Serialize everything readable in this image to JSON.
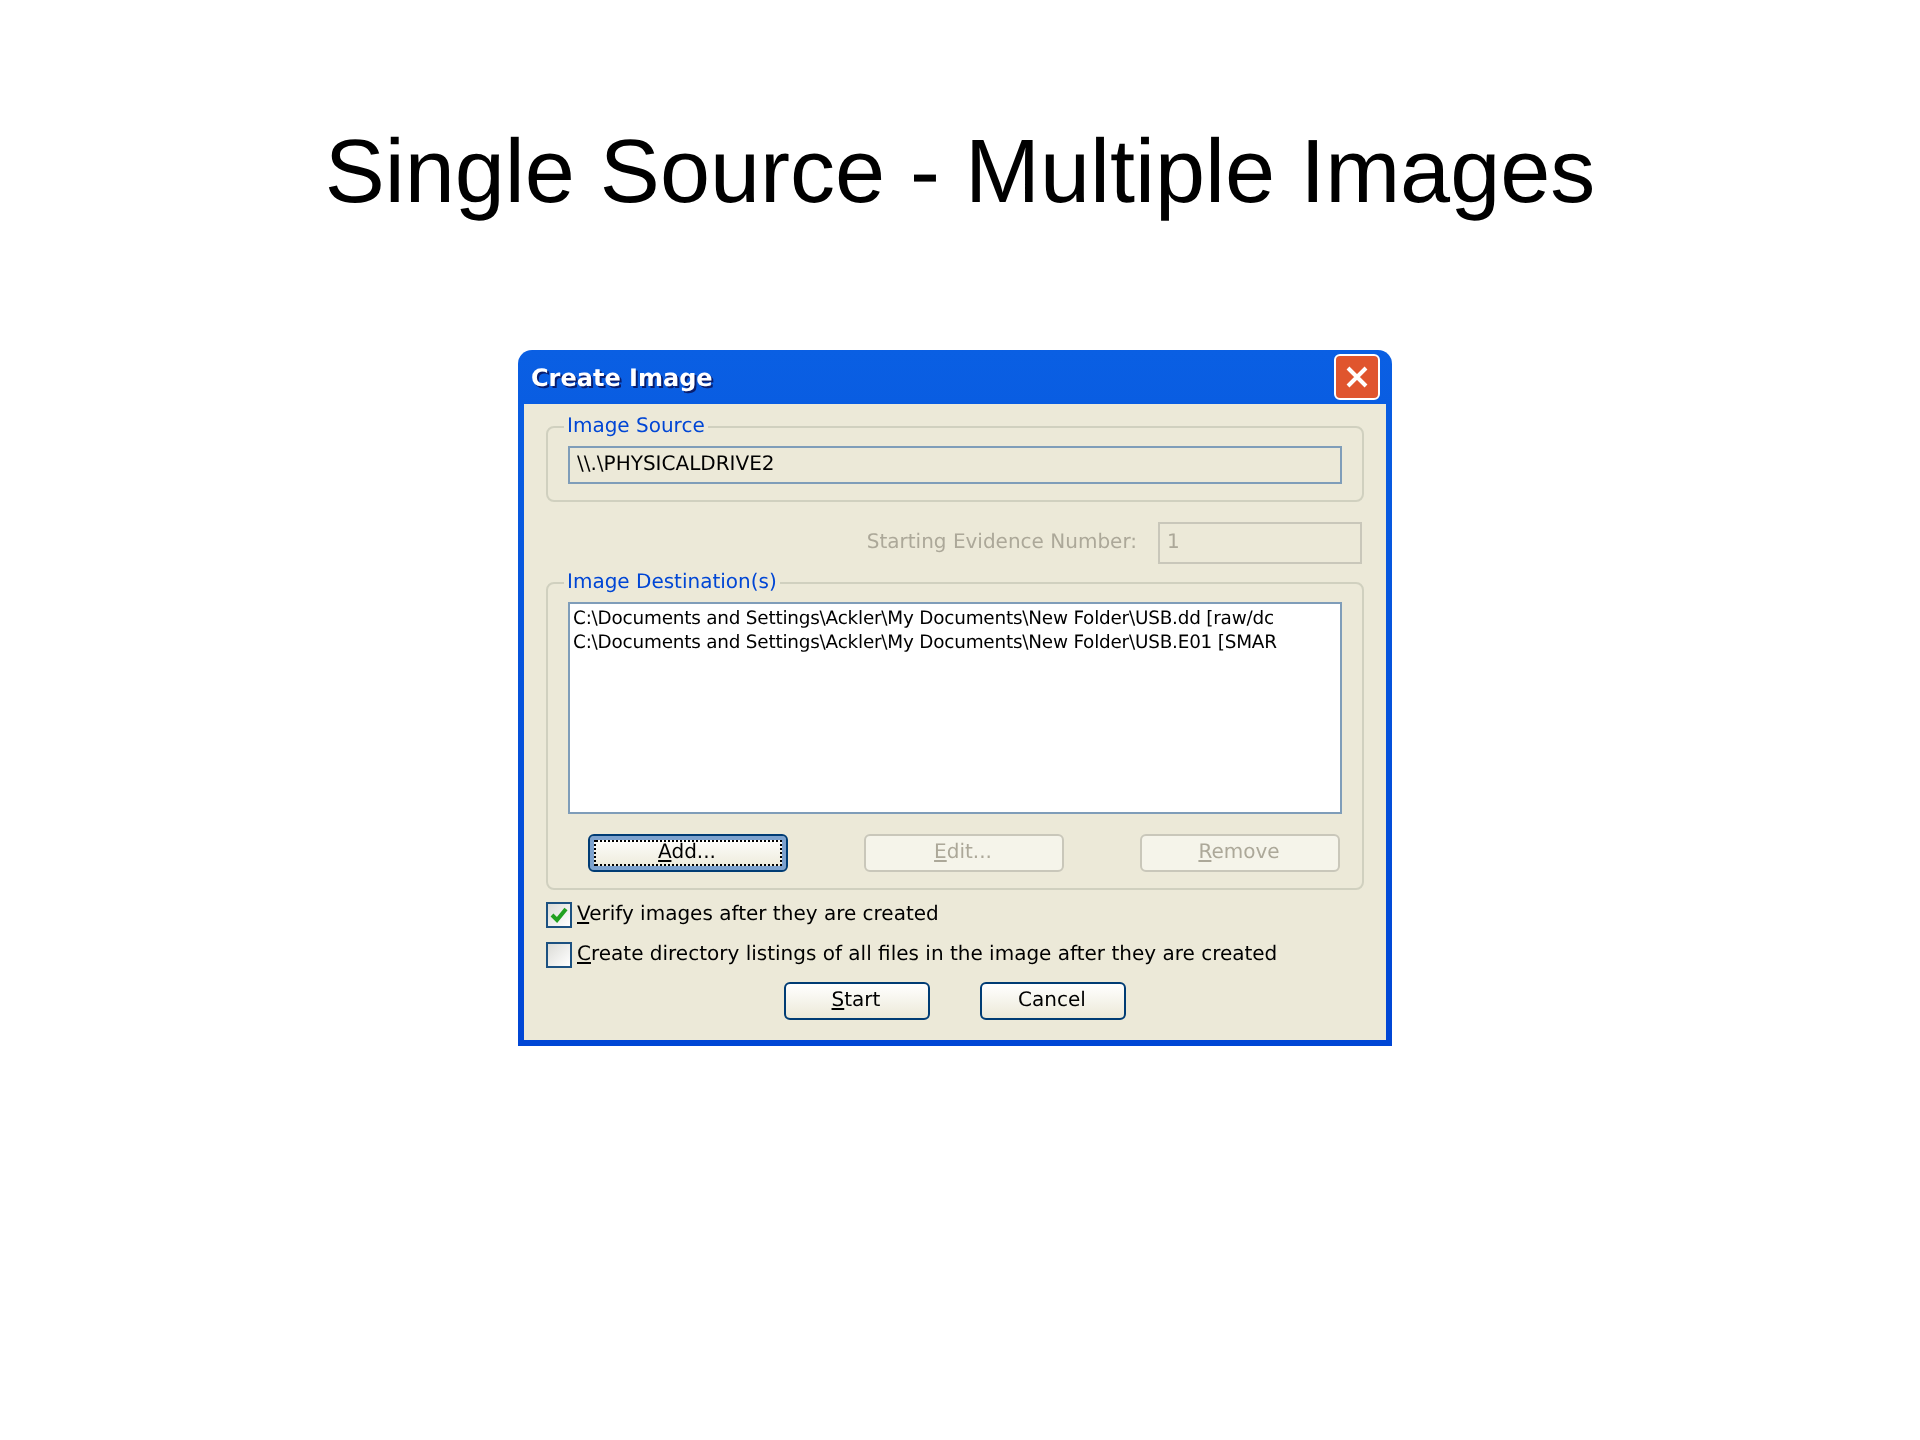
{
  "slide": {
    "title": "Single Source - Multiple Images"
  },
  "dialog": {
    "title": "Create Image",
    "image_source": {
      "label": "Image Source",
      "value": "\\\\.\\PHYSICALDRIVE2"
    },
    "starting_evidence_number": {
      "label": "Starting Evidence Number:",
      "value": "1",
      "disabled": true
    },
    "image_destinations": {
      "label": "Image Destination(s)",
      "items": [
        {
          "text": "C:\\Documents and Settings\\Ackler\\My Documents\\New Folder\\USB.dd [raw/dc"
        },
        {
          "text": "C:\\Documents and Settings\\Ackler\\My Documents\\New Folder\\USB.E01 [SMAR"
        }
      ],
      "buttons": [
        {
          "label": "Add...",
          "access_key_underlined": true,
          "disabled": false,
          "focused": true
        },
        {
          "label": "Edit...",
          "access_key_underlined": true,
          "disabled": true,
          "focused": false
        },
        {
          "label": "Remove",
          "access_key_underlined": true,
          "disabled": true,
          "focused": false
        }
      ]
    },
    "options": [
      {
        "label": "Verify images after they are created",
        "access_key_underlined": true,
        "checked": true
      },
      {
        "label": "Create directory listings of all files in the image after they are created",
        "access_key_underlined": true,
        "checked": false
      }
    ],
    "buttons": [
      {
        "label": "Start",
        "access_key_underlined": true,
        "disabled": false,
        "focused": false
      },
      {
        "label": "Cancel",
        "access_key_underlined": false,
        "disabled": false,
        "focused": false
      }
    ]
  }
}
